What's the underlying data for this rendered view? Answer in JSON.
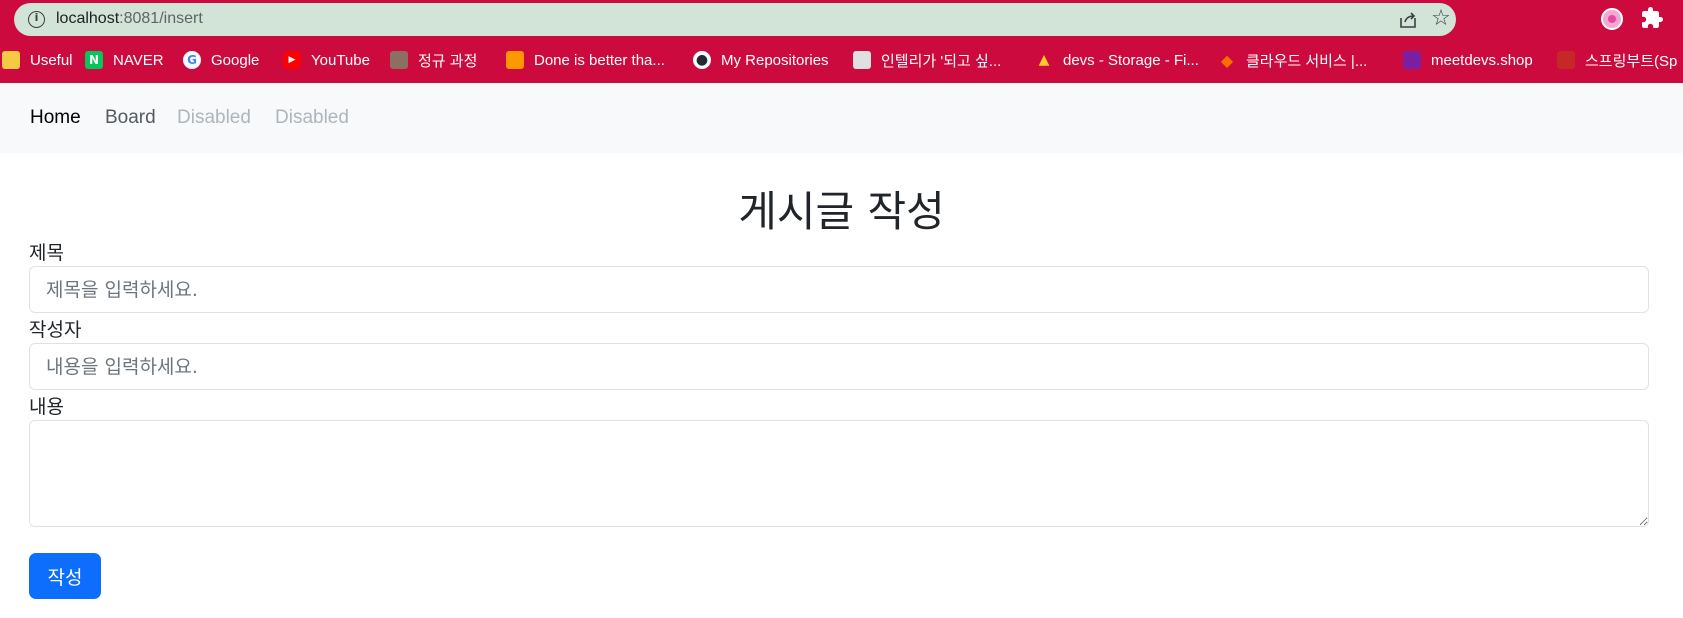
{
  "browser": {
    "url_host": "localhost",
    "url_rest": ":8081/insert",
    "bookmarks": [
      {
        "label": "Useful",
        "icon": "folder-icon",
        "color": "#f6c945"
      },
      {
        "label": "NAVER",
        "icon": "naver-icon",
        "color": "#03c75a"
      },
      {
        "label": "Google",
        "icon": "google-icon",
        "color": "#4285f4"
      },
      {
        "label": "YouTube",
        "icon": "youtube-icon",
        "color": "#ff0000"
      },
      {
        "label": "정규 과정",
        "icon": "bookmark-favicon-icon",
        "color": "#8d6e63"
      },
      {
        "label": "Done is better tha...",
        "icon": "bookmark-favicon-icon",
        "color": "#ff9800"
      },
      {
        "label": "My Repositories",
        "icon": "github-icon",
        "color": "#24292f"
      },
      {
        "label": "인텔리가 '되고 싶...",
        "icon": "bookmark-favicon-icon",
        "color": "#e0e0e0"
      },
      {
        "label": "devs - Storage - Fi...",
        "icon": "firebase-icon",
        "color": "#ffca28"
      },
      {
        "label": "클라우드 서비스 |...",
        "icon": "cloud-service-icon",
        "color": "#ff6d00"
      },
      {
        "label": "meetdevs.shop",
        "icon": "bookmark-favicon-icon",
        "color": "#7b1fa2"
      },
      {
        "label": "스프링부트(Sp",
        "icon": "bookmark-favicon-icon",
        "color": "#c62828"
      }
    ]
  },
  "navbar": {
    "items": [
      {
        "label": "Home",
        "state": "active"
      },
      {
        "label": "Board",
        "state": "normal"
      },
      {
        "label": "Disabled",
        "state": "disabled"
      },
      {
        "label": "Disabled",
        "state": "disabled"
      }
    ]
  },
  "form": {
    "title": "게시글 작성",
    "title_label": "제목",
    "title_placeholder": "제목을 입력하세요.",
    "writer_label": "작성자",
    "writer_placeholder": "내용을 입력하세요.",
    "content_label": "내용",
    "content_value": "",
    "submit_label": "작성"
  },
  "colors": {
    "chrome_bar": "#cc0a3e",
    "url_bar": "#d2e3d8",
    "primary_button": "#0d6efd"
  }
}
